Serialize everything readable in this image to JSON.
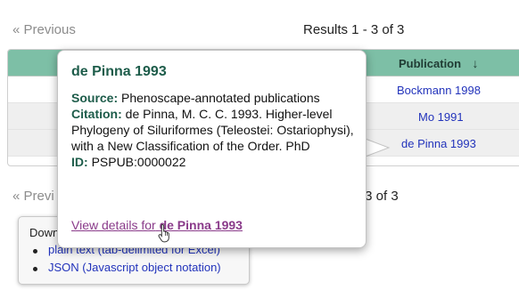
{
  "pager_top": {
    "previous": "« Previous",
    "results": "Results 1 - 3 of 3"
  },
  "table": {
    "publication_header": "Publication",
    "sort_glyph": "↓",
    "rows": [
      {
        "publication": "Bockmann 1998"
      },
      {
        "publication": "Mo 1991"
      },
      {
        "publication": "de Pinna 1993"
      }
    ]
  },
  "pager_bottom": {
    "previous": "« Previ",
    "results": "- 3 of 3"
  },
  "download": {
    "title": "Down",
    "options": [
      "plain text (tab-delimited for Excel)",
      "JSON (Javascript object notation)"
    ]
  },
  "popover": {
    "title": "de Pinna 1993",
    "source_label": "Source:",
    "source_value": "Phenoscape-annotated publications",
    "citation_label": "Citation:",
    "citation_value": "de Pinna, M. C. C. 1993. Higher-level Phylogeny of Siluriformes (Teleostei: Ostariophysi), with a New Classification of the Order. PhD",
    "id_label": "ID:",
    "id_value": "PSPUB:0000022",
    "link_prefix": "View details for",
    "link_target": "de Pinna 1993"
  },
  "cursor_icon": "hand-pointer-icon",
  "colors": {
    "header_green": "#7dbfa6",
    "title_green": "#1d5c4a",
    "link_blue": "#2233bb",
    "visited_purple": "#8a3b8a"
  }
}
